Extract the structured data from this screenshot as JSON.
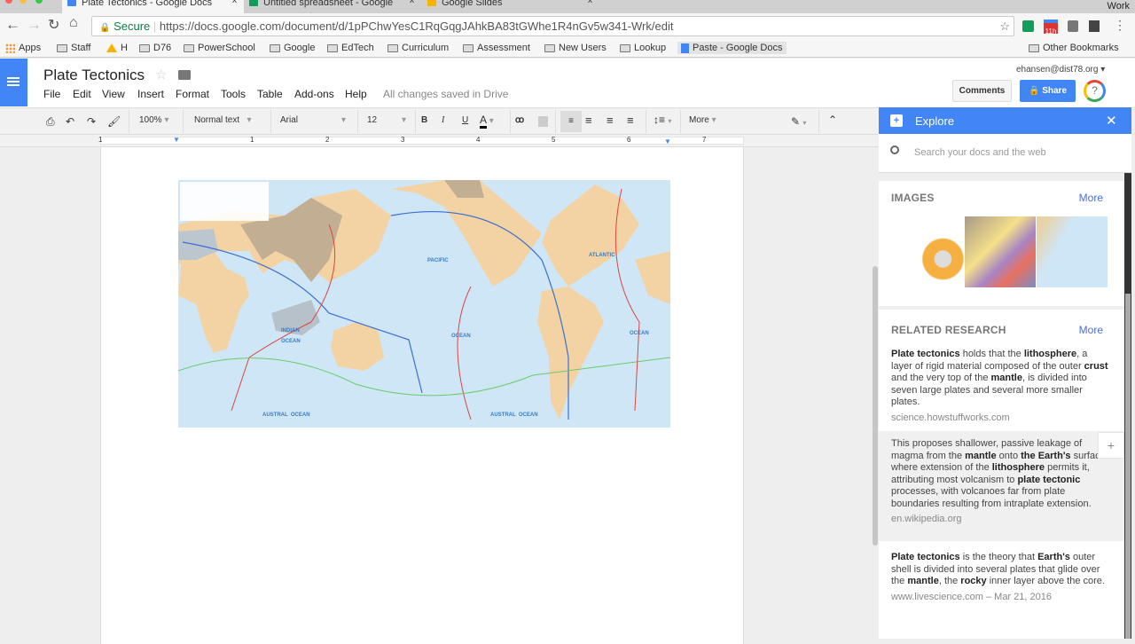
{
  "browser": {
    "tabs": [
      {
        "title": "Plate Tectonics - Google Docs",
        "color": "#4285f4"
      },
      {
        "title": "Untitled spreadsheet - Google",
        "color": "#0f9d58"
      },
      {
        "title": "Google Slides",
        "color": "#f4b400"
      }
    ],
    "tab_close": "x",
    "secure_label": "Secure",
    "url": "https://docs.google.com/document/d/1pPChwYesC1RqGqgJAhkBA83tGWhe1R4nGv5w341-Wrk/edit",
    "bookmarks": [
      "Apps",
      "Staff",
      "H",
      "D76",
      "PowerSchool",
      "Google",
      "EdTech",
      "Curriculum",
      "Assessment",
      "New Users",
      "Lookup",
      "Paste - Google Docs"
    ],
    "other_bookmarks": "Other Bookmarks",
    "calendar_badge": "11h",
    "user_corner": "Work"
  },
  "doc": {
    "title": "Plate Tectonics",
    "menus": [
      "File",
      "Edit",
      "View",
      "Insert",
      "Format",
      "Tools",
      "Table",
      "Add-ons",
      "Help"
    ],
    "save_status": "All changes saved in Drive",
    "account": "ehansen@dist78.org",
    "comments_label": "Comments",
    "share_label": "Share",
    "help": "?"
  },
  "toolbar": {
    "zoom": "100%",
    "style": "Normal text",
    "font": "Arial",
    "size": "12",
    "bold": "B",
    "italic": "I",
    "underline": "U",
    "color": "A",
    "more": "More"
  },
  "ruler": [
    "1",
    "1",
    "2",
    "3",
    "4",
    "5",
    "6",
    "7"
  ],
  "map": {
    "labels": [
      "PACIFIC",
      "ATLANTIC",
      "INDIAN",
      "OCEAN",
      "OCEAN",
      "OCEAN",
      "AUSTRAL  OCEAN",
      "AUSTRAL  OCEAN"
    ]
  },
  "explore": {
    "title": "Explore",
    "search_placeholder": "Search your docs and the web",
    "images_heading": "IMAGES",
    "more": "More",
    "research_heading": "RELATED RESEARCH",
    "results": [
      {
        "html": "<b>Plate tectonics</b> holds that the <b>lithosphere</b>, a layer of rigid material composed of the outer <b>crust</b> and the very top of the <b>mantle</b>, is divided into seven large plates and several more smaller plates.",
        "source": "science.howstuffworks.com"
      },
      {
        "html": "This proposes shallower, passive leakage of magma from the <b>mantle</b> onto <b>the Earth's</b> surface where extension of the <b>lithosphere</b> permits it, attributing most volcanism to <b>plate tectonic</b> processes, with volcanoes far from plate boundaries resulting from intraplate extension.",
        "source": "en.wikipedia.org"
      },
      {
        "html": "<b>Plate tectonics</b> is the theory that <b>Earth's</b> outer shell is divided into several plates that glide over the <b>mantle</b>, the <b>rocky</b> inner layer above the core.",
        "source": "www.livescience.com – Mar 21, 2016"
      }
    ],
    "add": "+"
  }
}
